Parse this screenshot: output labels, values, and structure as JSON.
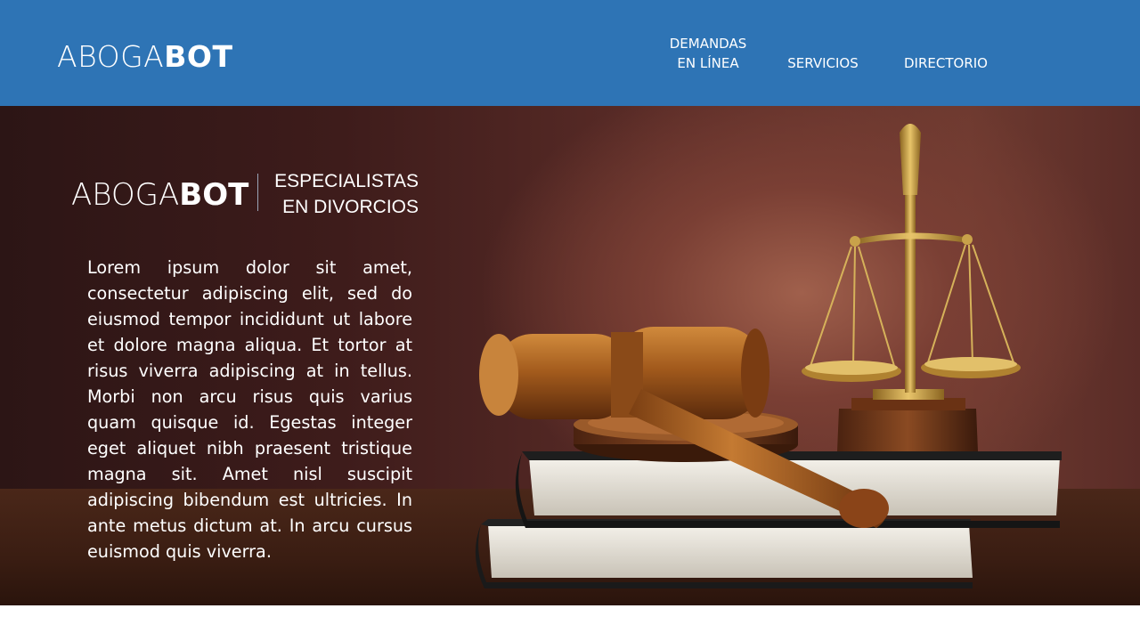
{
  "header": {
    "logo_light": "ABOGA",
    "logo_bold": "BOT",
    "nav": {
      "demandas_line1": "DEMANDAS",
      "demandas_line2": "EN LÍNEA",
      "servicios": "SERVICIOS",
      "directorio": "DIRECTORIO"
    }
  },
  "hero": {
    "logo_light": "ABOGA",
    "logo_bold": "BOT",
    "tagline_line1": "ESPECIALISTAS",
    "tagline_line2": "EN DIVORCIOS",
    "body": "Lorem ipsum dolor sit amet, consectetur adipiscing elit, sed do eiusmod tempor incididunt ut labore et dolore magna aliqua. Et tortor at risus viverra adipiscing at in tellus. Morbi non arcu risus quis varius quam quisque id. Egestas integer eget aliquet nibh praesent tristique magna sit. Amet nisl suscipit adipiscing bibendum est ultricies. In ante metus dictum at. In arcu cursus euismod quis viverra.",
    "image": "gavel-scales-books-image"
  },
  "colors": {
    "header_bg": "#2e74b5",
    "text": "#ffffff",
    "hero_dark": "#2c1515"
  }
}
